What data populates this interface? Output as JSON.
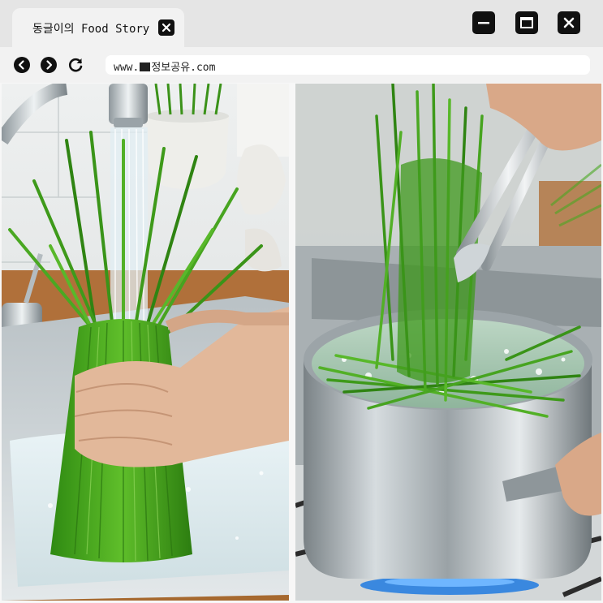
{
  "browser": {
    "tab": {
      "title": "동글이의 Food Story"
    },
    "address_bar": {
      "prefix": "www.",
      "suffix": "정보공유.com"
    },
    "window_controls": [
      "minimize",
      "maximize",
      "close"
    ],
    "nav_icons": [
      "back-icon",
      "forward-icon",
      "reload-icon"
    ]
  },
  "content": {
    "images": [
      {
        "name": "washing-chives-photo"
      },
      {
        "name": "blanching-chives-photo"
      }
    ]
  },
  "colors": {
    "tab_bar": "#e5e5e5",
    "toolbar": "#f2f2f2",
    "icon": "#111111",
    "chive_green": "#3f9a1c"
  }
}
